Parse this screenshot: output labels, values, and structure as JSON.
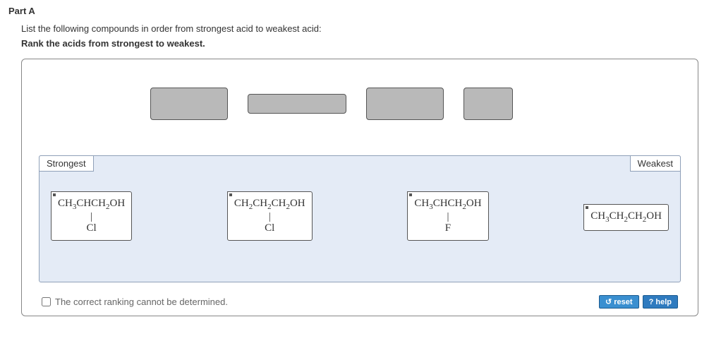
{
  "part": {
    "title": "Part A"
  },
  "instructions": {
    "line1": "List the following compounds in order from strongest acid to weakest acid:",
    "line2": "Rank the acids from strongest to weakest."
  },
  "rank": {
    "strongest": "Strongest",
    "weakest": "Weakest"
  },
  "compounds": [
    {
      "formula_html": "CH<sub>3</sub>CHCH<sub>2</sub>OH",
      "subst": "Cl"
    },
    {
      "formula_html": "CH<sub>2</sub>CH<sub>2</sub>CH<sub>2</sub>OH",
      "subst": "Cl"
    },
    {
      "formula_html": "CH<sub>3</sub>CHCH<sub>2</sub>OH",
      "subst": "F"
    },
    {
      "formula_html": "CH<sub>3</sub>CH<sub>2</sub>CH<sub>2</sub>OH",
      "subst": null
    }
  ],
  "footer": {
    "checkbox_label": "The correct ranking cannot be determined.",
    "reset": "reset",
    "help": "help"
  }
}
